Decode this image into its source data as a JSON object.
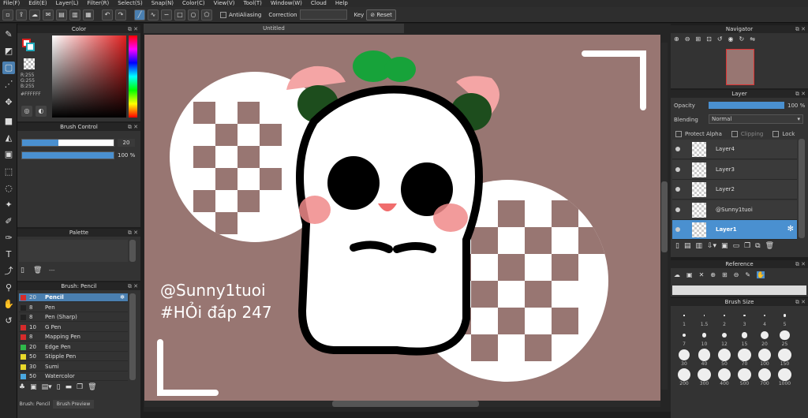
{
  "menu": [
    "File(F)",
    "Edit(E)",
    "Layer(L)",
    "Filter(R)",
    "Select(S)",
    "Snap(N)",
    "Color(C)",
    "View(V)",
    "Tool(T)",
    "Window(W)",
    "Cloud",
    "Help"
  ],
  "toolbar": {
    "antialias_label": "AntiAliasing",
    "correction_label": "Correction",
    "key_label": "Key",
    "reset_label": "Reset"
  },
  "canvas": {
    "tab_title": "Untitled",
    "watermark_line1": "@Sunny1tuoi",
    "watermark_line2": "#HỎi đáp 247"
  },
  "color_panel": {
    "title": "Color",
    "r": "R:255",
    "g": "G:255",
    "b": "B:255",
    "hex": "#FFFFFF"
  },
  "brush_control": {
    "title": "Brush Control",
    "size": "20",
    "opacity": "100 %"
  },
  "palette": {
    "title": "Palette",
    "dash": "---"
  },
  "brush_list": {
    "title": "Brush: Pencil",
    "items": [
      {
        "size": "20",
        "name": "Pencil",
        "color": "#d62b2b"
      },
      {
        "size": "8",
        "name": "Pen",
        "color": "#222222"
      },
      {
        "size": "8",
        "name": "Pen (Sharp)",
        "color": "#222222"
      },
      {
        "size": "10",
        "name": "G Pen",
        "color": "#d62b2b"
      },
      {
        "size": "8",
        "name": "Mapping Pen",
        "color": "#d62b2b"
      },
      {
        "size": "20",
        "name": "Edge Pen",
        "color": "#2fb84a"
      },
      {
        "size": "50",
        "name": "Stipple Pen",
        "color": "#e8d82a"
      },
      {
        "size": "30",
        "name": "Sumi",
        "color": "#e8d82a"
      },
      {
        "size": "50",
        "name": "Watercolor",
        "color": "#4aa8e0"
      }
    ],
    "tab_pencil": "Brush: Pencil",
    "tab_preview": "Brush Preview"
  },
  "navigator": {
    "title": "Navigator"
  },
  "layer_panel": {
    "title": "Layer",
    "opacity_label": "Opacity",
    "opacity_value": "100 %",
    "blending_label": "Blending",
    "blending_value": "Normal",
    "protect_alpha": "Protect Alpha",
    "clipping": "Clipping",
    "lock": "Lock",
    "layers": [
      "Layer4",
      "Layer3",
      "Layer2",
      "@Sunny1tuoi",
      "Layer1"
    ]
  },
  "reference": {
    "title": "Reference"
  },
  "brush_size": {
    "title": "Brush Size",
    "sizes": [
      "1",
      "1.5",
      "2",
      "3",
      "4",
      "5",
      "7",
      "10",
      "12",
      "15",
      "20",
      "25",
      "30",
      "40",
      "50",
      "70",
      "100",
      "150",
      "200",
      "300",
      "400",
      "500",
      "700",
      "1000"
    ]
  }
}
